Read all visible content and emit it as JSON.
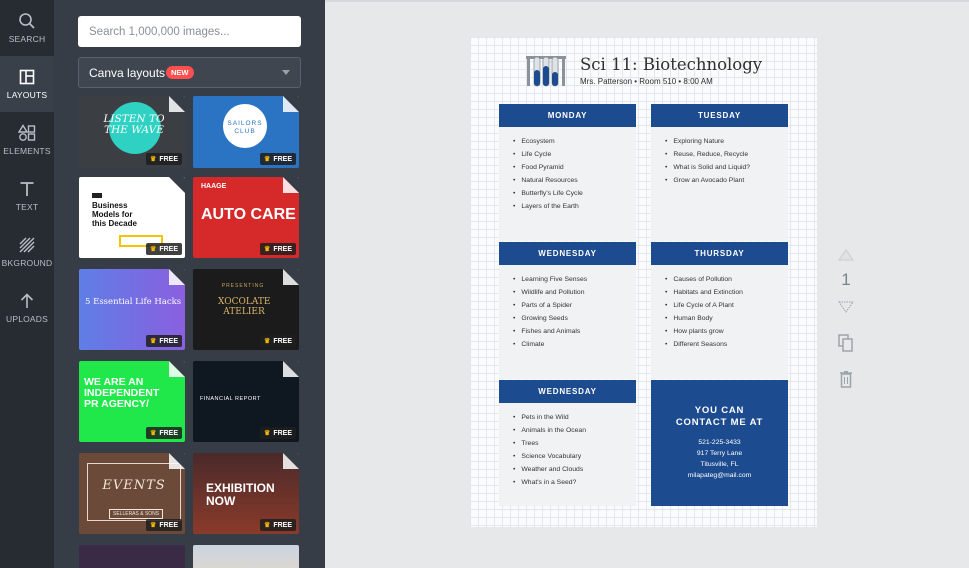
{
  "rail": [
    {
      "label": "SEARCH",
      "icon": "search-icon"
    },
    {
      "label": "LAYOUTS",
      "icon": "layouts-icon"
    },
    {
      "label": "ELEMENTS",
      "icon": "elements-icon"
    },
    {
      "label": "TEXT",
      "icon": "text-icon"
    },
    {
      "label": "BKGROUND",
      "icon": "background-icon"
    },
    {
      "label": "UPLOADS",
      "icon": "uploads-icon"
    }
  ],
  "panel": {
    "search_placeholder": "Search 1,000,000 images...",
    "select_label": "Canva layouts",
    "select_badge": "NEW",
    "free_label": "FREE"
  },
  "templates": {
    "t1": "LISTEN TO THE WAVE",
    "t2a": "SAILORS",
    "t2b": "CLUB",
    "t3": "Business Models for this Decade",
    "t4a": "HAAGE",
    "t4b": "AUTO CARE",
    "t5": "5 Essential Life Hacks",
    "t6a": "PRESENTING",
    "t6b": "XOCOLATE ATELIER",
    "t7": "WE ARE AN INDEPENDENT PR AGENCY/",
    "t8": "FINANCIAL REPORT",
    "t9a": "EVENTS",
    "t9b": "SELLERAS & SONS",
    "t10": "EXHIBITION NOW"
  },
  "document": {
    "title": "Sci 11: Biotechnology",
    "subtitle": "Mrs. Patterson  •  Room 510  •  8:00 AM",
    "days": [
      {
        "name": "MONDAY",
        "items": [
          "Ecosystem",
          "Life Cycle",
          "Food Pyramid",
          "Natural Resources",
          "Butterfly's Life Cycle",
          "Layers of the Earth"
        ]
      },
      {
        "name": "TUESDAY",
        "items": [
          "Exploring Nature",
          "Reuse, Reduce, Recycle",
          "What is Solid and Liquid?",
          "Grow an Avocado Plant"
        ]
      },
      {
        "name": "WEDNESDAY",
        "items": [
          "Learning Five Senses",
          "Wildlife and Pollution",
          "Parts of a Spider",
          "Growing Seeds",
          "Fishes and Animals",
          "Climate"
        ]
      },
      {
        "name": "THURSDAY",
        "items": [
          "Causes of Pollution",
          "Habitats and Extinction",
          "Life Cycle of A Plant",
          "Human Body",
          "How plants grow",
          "Different Seasons"
        ]
      },
      {
        "name": "WEDNESDAY",
        "items": [
          "Pets in the Wild",
          "Animals in the Ocean",
          "Trees",
          "Science Vocabulary",
          "Weather and Clouds",
          "What's in a Seed?"
        ]
      }
    ],
    "contact": {
      "heading1": "YOU CAN",
      "heading2": "CONTACT ME AT",
      "phone": "521-225-3433",
      "street": "917 Terry Lane",
      "city": "Titusville, FL",
      "email": "milapateg@mail.com"
    }
  },
  "page_number": "1",
  "colors": {
    "accent": "#1d4b8f",
    "new_badge": "#ff4f4f",
    "rail_bg": "#272c33",
    "panel_bg": "#373d46"
  }
}
